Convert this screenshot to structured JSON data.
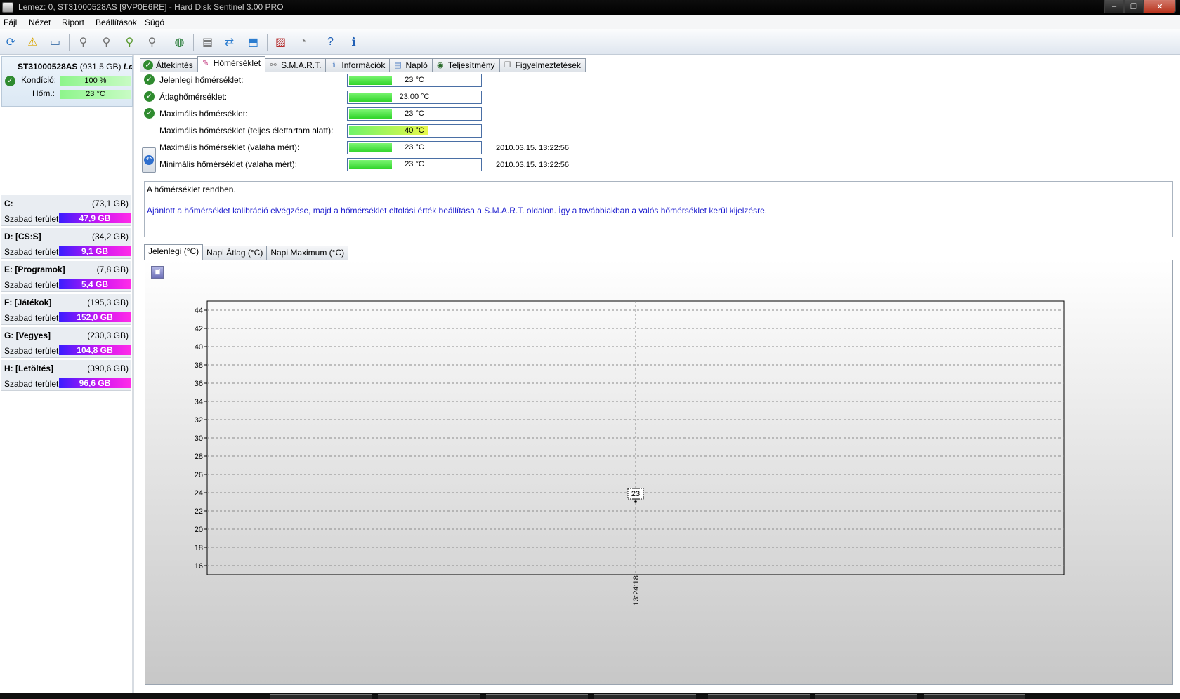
{
  "window": {
    "title": "Lemez: 0, ST31000528AS [9VP0E6RE]  -  Hard Disk Sentinel 3.00 PRO",
    "minimize": "–",
    "maximize": "❐",
    "close": "✕"
  },
  "menu": [
    "Fájl",
    "Nézet",
    "Riport",
    "Beállítások",
    "Súgó"
  ],
  "disk": {
    "name": "ST31000528AS",
    "size": "(931,5 GB)",
    "extra": "Lem",
    "health_label": "Kondíció:",
    "health_value": "100 %",
    "health_fraction": 1.0,
    "temp_label": "Hőm.:",
    "temp_value": "23 °C"
  },
  "volumes": [
    {
      "name": "C:",
      "size": "(73,1 GB)",
      "free_label": "Szabad terület",
      "free": "47,9 GB"
    },
    {
      "name": "D: [CS:S]",
      "size": "(34,2 GB)",
      "free_label": "Szabad terület",
      "free": "9,1 GB"
    },
    {
      "name": "E: [Programok]",
      "size": "(7,8 GB)",
      "free_label": "Szabad terület",
      "free": "5,4 GB"
    },
    {
      "name": "F: [Játékok]",
      "size": "(195,3 GB)",
      "free_label": "Szabad terület",
      "free": "152,0 GB"
    },
    {
      "name": "G: [Vegyes]",
      "size": "(230,3 GB)",
      "free_label": "Szabad terület",
      "free": "104,8 GB"
    },
    {
      "name": "H: [Letöltés]",
      "size": "(390,6 GB)",
      "free_label": "Szabad terület",
      "free": "96,6 GB"
    }
  ],
  "tabs": [
    "Áttekintés",
    "Hőmérséklet",
    "S.M.A.R.T.",
    "Információk",
    "Napló",
    "Teljesítmény",
    "Figyelmeztetések"
  ],
  "active_tab": "Hőmérséklet",
  "temperatures": [
    {
      "label": "Jelenlegi hőmérséklet:",
      "value": "23 °C",
      "fraction": 0.33,
      "timestamp": ""
    },
    {
      "label": "Átlaghőmérséklet:",
      "value": "23,00 °C",
      "fraction": 0.33,
      "timestamp": ""
    },
    {
      "label": "Maximális hőmérséklet:",
      "value": "23 °C",
      "fraction": 0.33,
      "timestamp": ""
    },
    {
      "label": "Maximális hőmérséklet (teljes élettartam alatt):",
      "value": "40 °C",
      "fraction": 0.6,
      "timestamp": ""
    },
    {
      "label": "Maximális hőmérséklet (valaha mért):",
      "value": "23 °C",
      "fraction": 0.33,
      "timestamp": "2010.03.15. 13:22:56"
    },
    {
      "label": "Minimális hőmérséklet (valaha mért):",
      "value": "23 °C",
      "fraction": 0.33,
      "timestamp": "2010.03.15. 13:22:56"
    }
  ],
  "messages": {
    "status": "A hőmérséklet rendben.",
    "advice": "Ajánlott a hőmérséklet kalibráció elvégzése, majd a hőmérséklet eltolási érték beállítása a S.M.A.R.T. oldalon. Így a továbbiakban a valós hőmérséklet kerül kijelzésre."
  },
  "graph_tabs": [
    "Jelenlegi (°C)",
    "Napi Átlag (°C)",
    "Napi Maximum (°C)"
  ],
  "chart_data": {
    "type": "line",
    "title": "",
    "xlabel": "",
    "ylabel": "",
    "x": [
      "13:24:18"
    ],
    "series": [
      {
        "values": [
          23
        ]
      }
    ],
    "ylim": [
      15,
      45
    ],
    "yticks": [
      16,
      18,
      20,
      22,
      24,
      26,
      28,
      30,
      32,
      34,
      36,
      38,
      40,
      42,
      44
    ],
    "grid": true,
    "data_labels": [
      "23"
    ]
  }
}
